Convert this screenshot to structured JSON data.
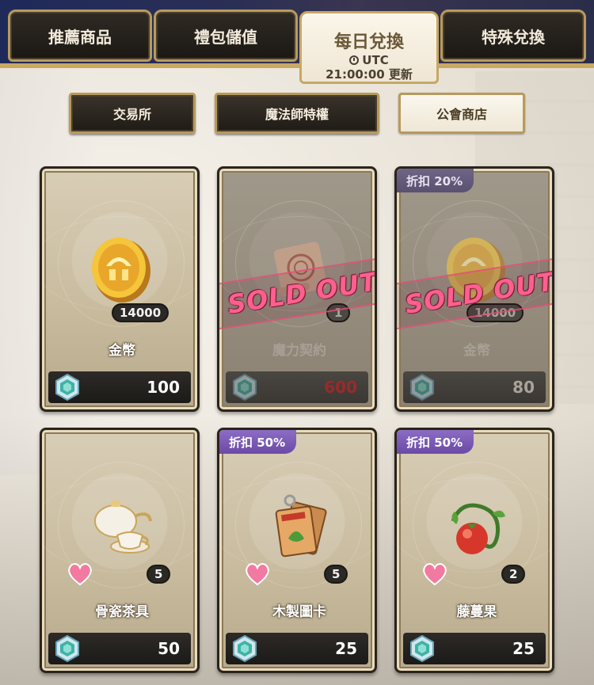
{
  "tabs": [
    {
      "label": "推薦商品"
    },
    {
      "label": "禮包儲值"
    },
    {
      "label": "每日兌換",
      "timer_label": "UTC",
      "reset_text": "21:00:00 更新"
    },
    {
      "label": "特殊兌換"
    }
  ],
  "subtabs": [
    {
      "label": "交易所"
    },
    {
      "label": "魔法師特權"
    },
    {
      "label": "公會商店"
    }
  ],
  "active_tab": "每日兌換",
  "active_subtab": "公會商店",
  "sold_out_label": "SOLD OUT",
  "cards": [
    {
      "name": "金幣",
      "quantity": "14000",
      "price": "100",
      "discount": "",
      "sold_out": false,
      "icon": "gold-coin-icon"
    },
    {
      "name": "魔力契約",
      "quantity": "1",
      "price": "600",
      "discount": "",
      "sold_out": true,
      "icon": "scroll-contract-icon"
    },
    {
      "name": "金幣",
      "quantity": "14000",
      "price": "80",
      "discount": "折扣 20%",
      "sold_out": true,
      "icon": "gold-coin-icon"
    },
    {
      "name": "骨瓷茶具",
      "quantity": "5",
      "price": "50",
      "discount": "",
      "sold_out": false,
      "icon": "tea-set-icon",
      "favorite": true
    },
    {
      "name": "木製圖卡",
      "quantity": "5",
      "price": "25",
      "discount": "折扣 50%",
      "sold_out": false,
      "icon": "wooden-cards-icon",
      "favorite": true
    },
    {
      "name": "藤蔓果",
      "quantity": "2",
      "price": "25",
      "discount": "折扣 50%",
      "sold_out": false,
      "icon": "vine-fruit-icon",
      "favorite": true
    }
  ],
  "colors": {
    "tab_border": "#b79a5d",
    "discount_bg": "#7a5ab8",
    "sold_out": "#ff5f8f",
    "heart": "#f27aa0",
    "gem": "#3fb2a6"
  }
}
